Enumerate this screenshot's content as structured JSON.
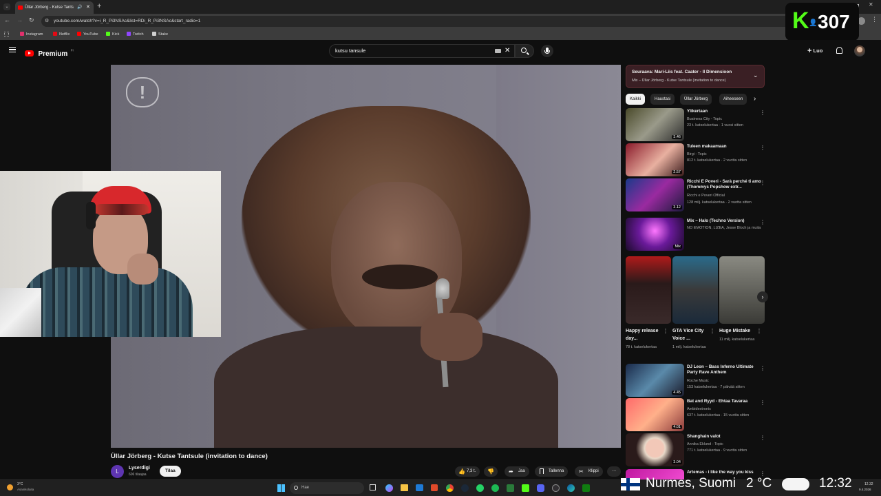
{
  "browser": {
    "tab_title": "Üllar Jörberg - Kutse Tants",
    "url": "youtube.com/watch?v=i_R_Pi3NSAc&list=RDi_R_Pi3NSAc&start_radio=1",
    "bookmarks": [
      {
        "label": "Instagram",
        "color": "#e1306c"
      },
      {
        "label": "Netflix",
        "color": "#e50914"
      },
      {
        "label": "YouTube",
        "color": "#ff0000"
      },
      {
        "label": "Kick",
        "color": "#53fc18"
      },
      {
        "label": "Twitch",
        "color": "#9146ff"
      },
      {
        "label": "Stake",
        "color": "#cfcfcf"
      }
    ]
  },
  "kick_overlay": {
    "viewer_count": "307",
    "logo_letter": "K",
    "accent": "#53fc18"
  },
  "youtube": {
    "logo_label": "Premium",
    "logo_sup": "FI",
    "search_value": "kutsu tansule",
    "create_label": "Luo"
  },
  "video": {
    "title": "Üllar Jörberg - Kutse Tantsule (invitation to dance)",
    "channel": "Lyserdigi",
    "channel_initial": "L",
    "subscribers": "606 tilaajaa",
    "subscribe_label": "Tilaa",
    "actions": {
      "likes": "7,3 t.",
      "share": "Jaa",
      "save": "Tallenna",
      "clip": "Klippi"
    }
  },
  "up_next": {
    "title": "Seuraava: Mari-Liis feat. Caater - II Dimensioon",
    "subtitle": "Mix – Üllar Jörberg - Kutse Tantsule (invitation to dance)"
  },
  "chips": [
    "Kaikki",
    "Haustasi",
    "Üllar Jörberg",
    "Aiheeseen"
  ],
  "recommendations": [
    {
      "title": "Ylikertaan",
      "channel": "Business City - Topic",
      "stats": "23 t. katselukertaa · 1 vuosi sitten",
      "duration": "3.46"
    },
    {
      "title": "Tuleen makaamaan",
      "channel": "Birgi - Topic",
      "stats": "812 t. katselukertaa · 2 vuotta sitten",
      "duration": "2.57"
    },
    {
      "title": "Ricchi E Poveri - Sarà perché ti amo (Thommys Popshow extr...",
      "channel": "Ricchi e Poveri Official",
      "stats": "128 milj. katselukertaa · 2 vuotta sitten",
      "duration": "3.12"
    },
    {
      "title": "Mix – Halo (Techno Version)",
      "channel": "NO EMOTION, LIZEA, Jesse Bloch ja muita",
      "stats": "",
      "duration": "Mix"
    }
  ],
  "shorts": [
    {
      "title": "Happy release day...",
      "views": "78 t. katselukertaa"
    },
    {
      "title": "GTA Vice City Voice ...",
      "views": "1 milj. katselukertaa"
    },
    {
      "title": "Huge Mistake",
      "views": "11 milj. katselukertaa"
    }
  ],
  "recommendations2": [
    {
      "title": "DJ Leon – Bass Inferno Ultimate Party  Rave Anthem",
      "channel": "Roche Music",
      "stats": "153 katselukertaa · 7 päivää sitten",
      "duration": "4.45"
    },
    {
      "title": "Bat and Ryyd - Ehtaa Tavaraa",
      "channel": "Ambidextronix",
      "stats": "637 t. katselukertaa · 15 vuotta sitten",
      "duration": "4.01"
    },
    {
      "title": "Shanghain valot",
      "channel": "Annika Eklund - Topic",
      "stats": "771 t. katselukertaa · 9 vuotta sitten",
      "duration": "3.04"
    },
    {
      "title": "Artemas - i like the way you kiss",
      "channel": "",
      "stats": "",
      "duration": ""
    }
  ],
  "taskbar": {
    "weather_temp": "3°C",
    "weather_desc": "Asanikolaita",
    "search_placeholder": "Hae",
    "time": "12.32",
    "date": "9.4.2026"
  },
  "weather_overlay": {
    "location": "Nurmes, Suomi",
    "temp": "2 °C",
    "time": "12:32"
  }
}
